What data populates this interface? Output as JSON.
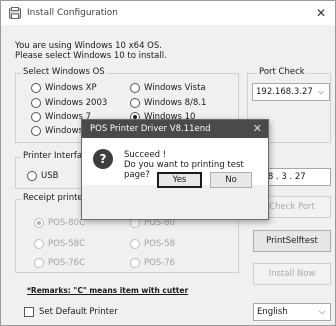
{
  "window": {
    "title": "Install Configuration",
    "close_glyph": "✕",
    "icon": "app-icon"
  },
  "intro": {
    "line1": "You are using Windows 10 x64 OS.",
    "line2": "Please select Windows 10 to install."
  },
  "windows_group": {
    "label": "Select Windows OS",
    "options": [
      "Windows XP",
      "Windows Vista",
      "Windows 2003",
      "Windows 8/8.1",
      "Windows 7",
      "Windows 10",
      "Windows"
    ],
    "selected": "Windows 10"
  },
  "port_check": {
    "label": "Port Check",
    "selected": "192.168.3.27"
  },
  "printer_interface": {
    "label": "Printer Interfac",
    "usb_label": "USB",
    "ip_value": "168 . 3 . 27"
  },
  "receipt_printer": {
    "label": "Receipt printer",
    "options": [
      "POS-80C",
      "POS-80",
      "POS-58C",
      "POS-58",
      "POS-76C",
      "POS-76"
    ],
    "selected": "POS-80C"
  },
  "buttons": {
    "check_port": "Check Port",
    "print_self_test": "PrintSelftest",
    "install_now": "Install Now"
  },
  "remarks": "*Remarks: \"C\" means item with cutter",
  "set_default_printer": "Set Default Printer",
  "language": {
    "selected": "English"
  },
  "dialog": {
    "title": "POS Printer Driver V8.11end",
    "close_glyph": "✕",
    "icon": "question-icon",
    "icon_glyph": "?",
    "line1": "Succeed !",
    "line2": "Do you want to printing test page?",
    "yes_label": "Yes",
    "no_label": "No"
  }
}
